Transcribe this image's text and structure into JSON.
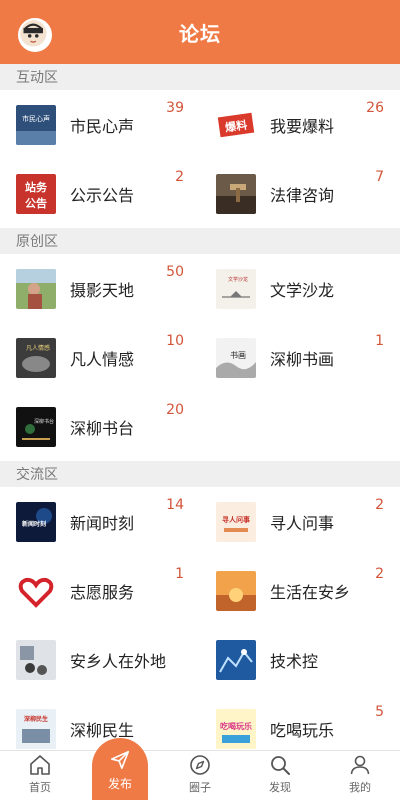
{
  "header": {
    "title": "论坛"
  },
  "sections": [
    {
      "title": "互动区",
      "items": [
        {
          "label": "市民心声",
          "count": "39"
        },
        {
          "label": "我要爆料",
          "count": "26"
        },
        {
          "label": "公示公告",
          "count": "2"
        },
        {
          "label": "法律咨询",
          "count": "7"
        }
      ]
    },
    {
      "title": "原创区",
      "items": [
        {
          "label": "摄影天地",
          "count": "50"
        },
        {
          "label": "文学沙龙",
          "count": ""
        },
        {
          "label": "凡人情感",
          "count": "10"
        },
        {
          "label": "深柳书画",
          "count": "1"
        },
        {
          "label": "深柳书台",
          "count": "20"
        }
      ]
    },
    {
      "title": "交流区",
      "items": [
        {
          "label": "新闻时刻",
          "count": "14"
        },
        {
          "label": "寻人问事",
          "count": "2"
        },
        {
          "label": "志愿服务",
          "count": "1"
        },
        {
          "label": "生活在安乡",
          "count": "2"
        },
        {
          "label": "安乡人在外地",
          "count": ""
        },
        {
          "label": "技术控",
          "count": ""
        },
        {
          "label": "深柳民生",
          "count": ""
        },
        {
          "label": "吃喝玩乐",
          "count": "5"
        }
      ]
    }
  ],
  "thumb_text": {
    "shimin": "市民心声",
    "baoliao": "爆料",
    "zhanwu": "站务",
    "gonggao": "公告",
    "wenxue": "文学沙龙",
    "fanren": "凡人情感",
    "shuhua": "书画",
    "shutai": "深柳书台",
    "xinwen": "新闻时刻",
    "xunren": "寻人问事",
    "minsheng": "深柳民生",
    "chihe": "吃喝玩乐"
  },
  "tabbar": {
    "home": "首页",
    "publish": "发布",
    "circle": "圈子",
    "discover": "发现",
    "mine": "我的"
  },
  "colors": {
    "accent": "#F07A45",
    "count": "#D2553A"
  }
}
